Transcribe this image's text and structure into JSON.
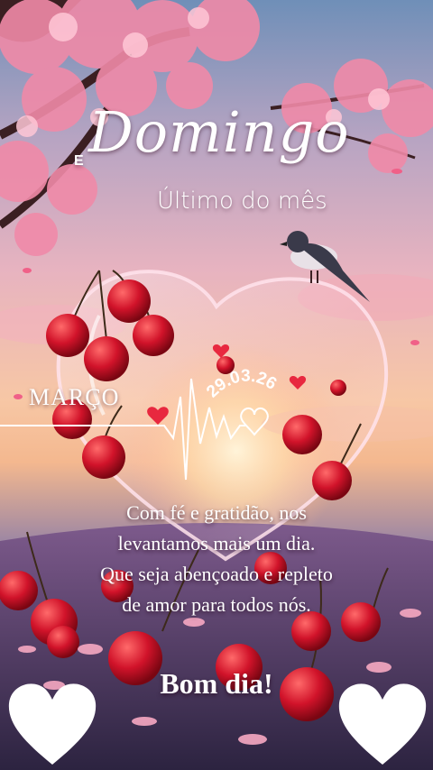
{
  "header": {
    "prefix": "E",
    "title": "Domingo",
    "subtitle": "Último do mês"
  },
  "heartbeat": {
    "month": "MARÇO",
    "date": "29.03.26"
  },
  "message": {
    "lines": [
      "Com fé e gratidão, nos",
      "levantamos mais um dia.",
      "Que seja abençoado e repleto",
      "de amor para todos nós."
    ]
  },
  "greeting": "Bom dia!",
  "colors": {
    "blossom": "#f08aa8",
    "cherry": "#d1132a",
    "text": "#ffffff"
  }
}
